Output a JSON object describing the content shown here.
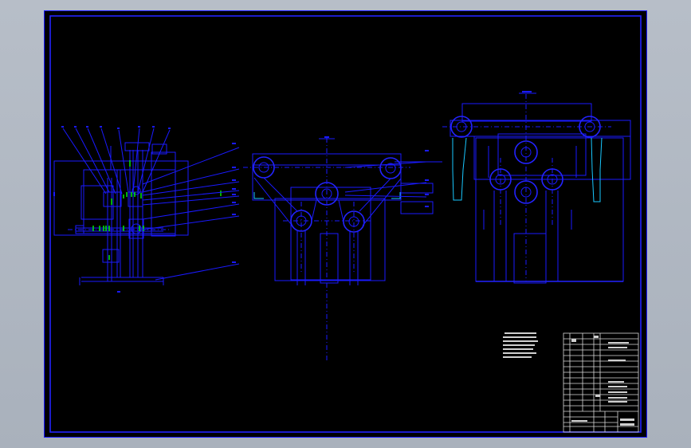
{
  "drawing": {
    "background": "#000000",
    "line_color": "#1a1aff",
    "highlight_color": "#00ff00",
    "cyan_color": "#19c8ff",
    "viewport_color": "#b0b8c2"
  },
  "views": [
    "side-view",
    "front-view",
    "rear-view"
  ],
  "title_block": {
    "present": true
  },
  "notes_block": {
    "present": true
  }
}
